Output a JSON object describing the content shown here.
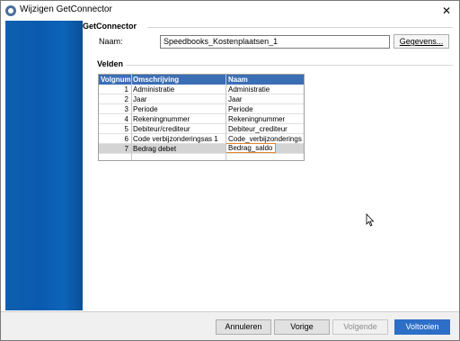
{
  "window": {
    "title": "Wijzigen GetConnector",
    "close_glyph": "✕"
  },
  "getconnector": {
    "section_title": "GetConnector",
    "name_label": "Naam:",
    "name_value": "Speedbooks_Kostenplaatsen_1",
    "details_button": "Gegevens..."
  },
  "fields": {
    "section_title": "Velden",
    "columns": [
      "Volgnummer",
      "Omschrijving",
      "Naam"
    ],
    "rows": [
      {
        "nr": "1",
        "desc": "Administratie",
        "name": "Administratie"
      },
      {
        "nr": "2",
        "desc": "Jaar",
        "name": "Jaar"
      },
      {
        "nr": "3",
        "desc": "Periode",
        "name": "Periode"
      },
      {
        "nr": "4",
        "desc": "Rekeningnummer",
        "name": "Rekeningnummer"
      },
      {
        "nr": "5",
        "desc": "Debiteur/crediteur",
        "name": "Debiteur_crediteur"
      },
      {
        "nr": "6",
        "desc": "Code verbijzonderingsas 1",
        "name": "Code_verbijzonderingsas"
      },
      {
        "nr": "7",
        "desc": "Bedrag debet",
        "name": "Bedrag_saldo"
      }
    ],
    "selected_row": 6
  },
  "footer": {
    "cancel": "Annuleren",
    "previous": "Vorige",
    "next": "Volgende",
    "finish": "Voltooien"
  },
  "colors": {
    "sidebar": "#0a5bb0",
    "grid_header": "#3b6eb4",
    "edit_highlight": "#e8822c",
    "primary_button": "#2d6fc7"
  }
}
